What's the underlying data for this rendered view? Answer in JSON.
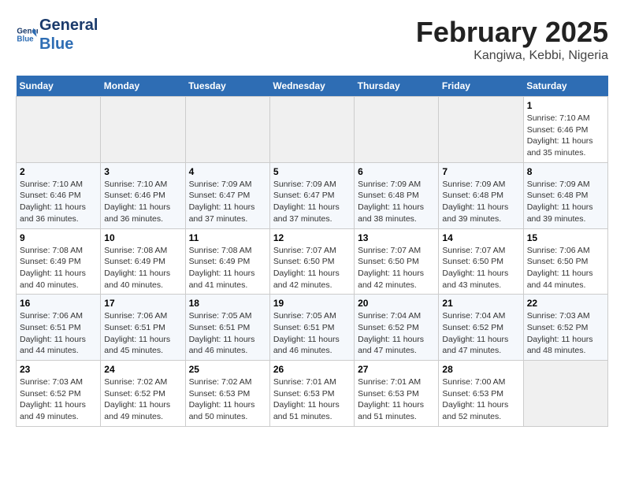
{
  "header": {
    "logo_line1": "General",
    "logo_line2": "Blue",
    "title": "February 2025",
    "subtitle": "Kangiwa, Kebbi, Nigeria"
  },
  "calendar": {
    "days_of_week": [
      "Sunday",
      "Monday",
      "Tuesday",
      "Wednesday",
      "Thursday",
      "Friday",
      "Saturday"
    ],
    "weeks": [
      [
        {
          "day": "",
          "info": "",
          "empty": true
        },
        {
          "day": "",
          "info": "",
          "empty": true
        },
        {
          "day": "",
          "info": "",
          "empty": true
        },
        {
          "day": "",
          "info": "",
          "empty": true
        },
        {
          "day": "",
          "info": "",
          "empty": true
        },
        {
          "day": "",
          "info": "",
          "empty": true
        },
        {
          "day": "1",
          "info": "Sunrise: 7:10 AM\nSunset: 6:46 PM\nDaylight: 11 hours and 35 minutes.",
          "empty": false
        }
      ],
      [
        {
          "day": "2",
          "info": "Sunrise: 7:10 AM\nSunset: 6:46 PM\nDaylight: 11 hours and 36 minutes.",
          "empty": false
        },
        {
          "day": "3",
          "info": "Sunrise: 7:10 AM\nSunset: 6:46 PM\nDaylight: 11 hours and 36 minutes.",
          "empty": false
        },
        {
          "day": "4",
          "info": "Sunrise: 7:09 AM\nSunset: 6:47 PM\nDaylight: 11 hours and 37 minutes.",
          "empty": false
        },
        {
          "day": "5",
          "info": "Sunrise: 7:09 AM\nSunset: 6:47 PM\nDaylight: 11 hours and 37 minutes.",
          "empty": false
        },
        {
          "day": "6",
          "info": "Sunrise: 7:09 AM\nSunset: 6:48 PM\nDaylight: 11 hours and 38 minutes.",
          "empty": false
        },
        {
          "day": "7",
          "info": "Sunrise: 7:09 AM\nSunset: 6:48 PM\nDaylight: 11 hours and 39 minutes.",
          "empty": false
        },
        {
          "day": "8",
          "info": "Sunrise: 7:09 AM\nSunset: 6:48 PM\nDaylight: 11 hours and 39 minutes.",
          "empty": false
        }
      ],
      [
        {
          "day": "9",
          "info": "Sunrise: 7:08 AM\nSunset: 6:49 PM\nDaylight: 11 hours and 40 minutes.",
          "empty": false
        },
        {
          "day": "10",
          "info": "Sunrise: 7:08 AM\nSunset: 6:49 PM\nDaylight: 11 hours and 40 minutes.",
          "empty": false
        },
        {
          "day": "11",
          "info": "Sunrise: 7:08 AM\nSunset: 6:49 PM\nDaylight: 11 hours and 41 minutes.",
          "empty": false
        },
        {
          "day": "12",
          "info": "Sunrise: 7:07 AM\nSunset: 6:50 PM\nDaylight: 11 hours and 42 minutes.",
          "empty": false
        },
        {
          "day": "13",
          "info": "Sunrise: 7:07 AM\nSunset: 6:50 PM\nDaylight: 11 hours and 42 minutes.",
          "empty": false
        },
        {
          "day": "14",
          "info": "Sunrise: 7:07 AM\nSunset: 6:50 PM\nDaylight: 11 hours and 43 minutes.",
          "empty": false
        },
        {
          "day": "15",
          "info": "Sunrise: 7:06 AM\nSunset: 6:50 PM\nDaylight: 11 hours and 44 minutes.",
          "empty": false
        }
      ],
      [
        {
          "day": "16",
          "info": "Sunrise: 7:06 AM\nSunset: 6:51 PM\nDaylight: 11 hours and 44 minutes.",
          "empty": false
        },
        {
          "day": "17",
          "info": "Sunrise: 7:06 AM\nSunset: 6:51 PM\nDaylight: 11 hours and 45 minutes.",
          "empty": false
        },
        {
          "day": "18",
          "info": "Sunrise: 7:05 AM\nSunset: 6:51 PM\nDaylight: 11 hours and 46 minutes.",
          "empty": false
        },
        {
          "day": "19",
          "info": "Sunrise: 7:05 AM\nSunset: 6:51 PM\nDaylight: 11 hours and 46 minutes.",
          "empty": false
        },
        {
          "day": "20",
          "info": "Sunrise: 7:04 AM\nSunset: 6:52 PM\nDaylight: 11 hours and 47 minutes.",
          "empty": false
        },
        {
          "day": "21",
          "info": "Sunrise: 7:04 AM\nSunset: 6:52 PM\nDaylight: 11 hours and 47 minutes.",
          "empty": false
        },
        {
          "day": "22",
          "info": "Sunrise: 7:03 AM\nSunset: 6:52 PM\nDaylight: 11 hours and 48 minutes.",
          "empty": false
        }
      ],
      [
        {
          "day": "23",
          "info": "Sunrise: 7:03 AM\nSunset: 6:52 PM\nDaylight: 11 hours and 49 minutes.",
          "empty": false
        },
        {
          "day": "24",
          "info": "Sunrise: 7:02 AM\nSunset: 6:52 PM\nDaylight: 11 hours and 49 minutes.",
          "empty": false
        },
        {
          "day": "25",
          "info": "Sunrise: 7:02 AM\nSunset: 6:53 PM\nDaylight: 11 hours and 50 minutes.",
          "empty": false
        },
        {
          "day": "26",
          "info": "Sunrise: 7:01 AM\nSunset: 6:53 PM\nDaylight: 11 hours and 51 minutes.",
          "empty": false
        },
        {
          "day": "27",
          "info": "Sunrise: 7:01 AM\nSunset: 6:53 PM\nDaylight: 11 hours and 51 minutes.",
          "empty": false
        },
        {
          "day": "28",
          "info": "Sunrise: 7:00 AM\nSunset: 6:53 PM\nDaylight: 11 hours and 52 minutes.",
          "empty": false
        },
        {
          "day": "",
          "info": "",
          "empty": true
        }
      ]
    ]
  }
}
